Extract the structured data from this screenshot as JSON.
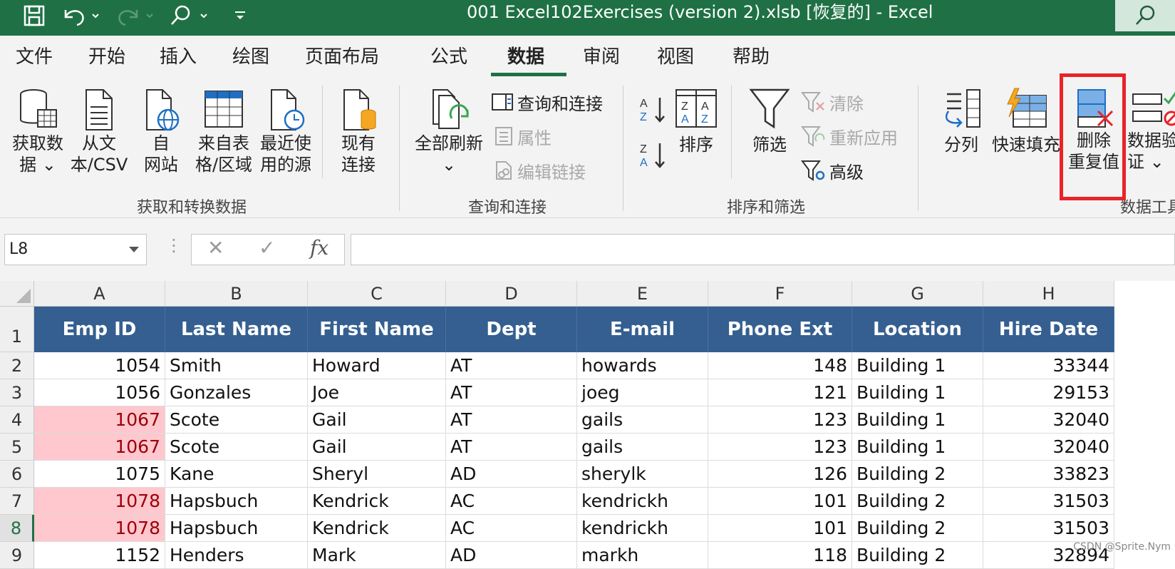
{
  "window": {
    "title": "001 Excel102Exercises (version 2).xlsb [恢复的]  -  Excel"
  },
  "ribbon_tabs": [
    {
      "label": "文件"
    },
    {
      "label": "开始"
    },
    {
      "label": "插入"
    },
    {
      "label": "绘图"
    },
    {
      "label": "页面布局"
    },
    {
      "label": "公式"
    },
    {
      "label": "数据",
      "active": true
    },
    {
      "label": "审阅"
    },
    {
      "label": "视图"
    },
    {
      "label": "帮助"
    }
  ],
  "ribbon": {
    "get_data": {
      "line1": "获取数",
      "line2": "据 ⌄"
    },
    "from_text": {
      "line1": "从文",
      "line2": "本/CSV"
    },
    "from_web": {
      "line1": "自",
      "line2": "网站"
    },
    "from_table": {
      "line1": "来自表",
      "line2": "格/区域"
    },
    "recent_sources": {
      "line1": "最近使",
      "line2": "用的源"
    },
    "existing_conn": {
      "line1": "现有",
      "line2": "连接"
    },
    "group_get_transform": "获取和转换数据",
    "refresh_all": {
      "line1": "全部刷新",
      "line2": "⌄"
    },
    "queries_connections": "查询和连接",
    "properties": "属性",
    "edit_links": "编辑链接",
    "group_queries": "查询和连接",
    "sort": "排序",
    "filter": "筛选",
    "clear": "清除",
    "reapply": "重新应用",
    "advanced": "高级",
    "group_sort_filter": "排序和筛选",
    "text_to_columns": "分列",
    "flash_fill": "快速填充",
    "remove_duplicates": {
      "line1": "删除",
      "line2": "重复值"
    },
    "data_validation": {
      "line1": "数据验",
      "line2": "证 ⌄"
    },
    "group_data_tools": "数据工具"
  },
  "formula_bar": {
    "name_box": "L8",
    "cancel": "✕",
    "enter": "✓",
    "fx": "fx",
    "formula": ""
  },
  "sheet": {
    "columns": [
      "A",
      "B",
      "C",
      "D",
      "E",
      "F",
      "G",
      "H"
    ],
    "headers": [
      "Emp ID",
      "Last Name",
      "First Name",
      "Dept",
      "E-mail",
      "Phone Ext",
      "Location",
      "Hire Date"
    ],
    "rows": [
      {
        "n": "2",
        "emp": "1054",
        "last": "Smith",
        "first": "Howard",
        "dept": "AT",
        "email": "howards",
        "ext": "148",
        "loc": "Building 1",
        "hire": "33344"
      },
      {
        "n": "3",
        "emp": "1056",
        "last": "Gonzales",
        "first": "Joe",
        "dept": "AT",
        "email": "joeg",
        "ext": "121",
        "loc": "Building 1",
        "hire": "29153"
      },
      {
        "n": "4",
        "emp": "1067",
        "last": "Scote",
        "first": "Gail",
        "dept": "AT",
        "email": "gails",
        "ext": "123",
        "loc": "Building 1",
        "hire": "32040",
        "dup": true
      },
      {
        "n": "5",
        "emp": "1067",
        "last": "Scote",
        "first": "Gail",
        "dept": "AT",
        "email": "gails",
        "ext": "123",
        "loc": "Building 1",
        "hire": "32040",
        "dup": true
      },
      {
        "n": "6",
        "emp": "1075",
        "last": "Kane",
        "first": "Sheryl",
        "dept": "AD",
        "email": "sherylk",
        "ext": "126",
        "loc": "Building 2",
        "hire": "33823"
      },
      {
        "n": "7",
        "emp": "1078",
        "last": "Hapsbuch",
        "first": "Kendrick",
        "dept": "AC",
        "email": "kendrickh",
        "ext": "101",
        "loc": "Building 2",
        "hire": "31503",
        "dup": true
      },
      {
        "n": "8",
        "emp": "1078",
        "last": "Hapsbuch",
        "first": "Kendrick",
        "dept": "AC",
        "email": "kendrickh",
        "ext": "101",
        "loc": "Building 2",
        "hire": "31503",
        "dup": true
      },
      {
        "n": "9",
        "emp": "1152",
        "last": "Henders",
        "first": "Mark",
        "dept": "AD",
        "email": "markh",
        "ext": "118",
        "loc": "Building 2",
        "hire": "32894"
      }
    ],
    "selected_row": "8",
    "header_row_number": "1"
  },
  "colors": {
    "titlebar": "#1f7145",
    "header_fill": "#355f91",
    "duplicate_fill": "#ffc7ce",
    "duplicate_text": "#9c0006",
    "highlight_box": "#e8232a"
  },
  "watermark": "CSDN @Sprite.Nym"
}
